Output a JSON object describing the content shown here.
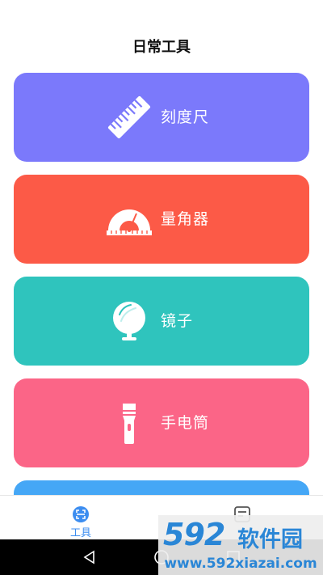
{
  "header": {
    "title": "日常工具"
  },
  "tools": [
    {
      "label": "刻度尺",
      "icon": "ruler-icon",
      "color": "#7b79fb"
    },
    {
      "label": "量角器",
      "icon": "protractor-icon",
      "color": "#fc5a47"
    },
    {
      "label": "镜子",
      "icon": "mirror-icon",
      "color": "#2fc4bd"
    },
    {
      "label": "手电筒",
      "icon": "flashlight-icon",
      "color": "#fb6587"
    }
  ],
  "partial_card": {
    "color": "#45a7f6"
  },
  "tabbar": {
    "tabs": [
      {
        "label": "工具",
        "icon": "tools-tab-icon",
        "active": true
      },
      {
        "label": "",
        "icon": "notes-tab-icon",
        "active": false
      }
    ],
    "active_color": "#3c8df0"
  },
  "navbar": {
    "buttons": [
      "back",
      "home",
      "recent"
    ]
  },
  "watermark": {
    "brand_number": "592",
    "brand_text": "软件园",
    "url": "www.592xiazai.com"
  }
}
